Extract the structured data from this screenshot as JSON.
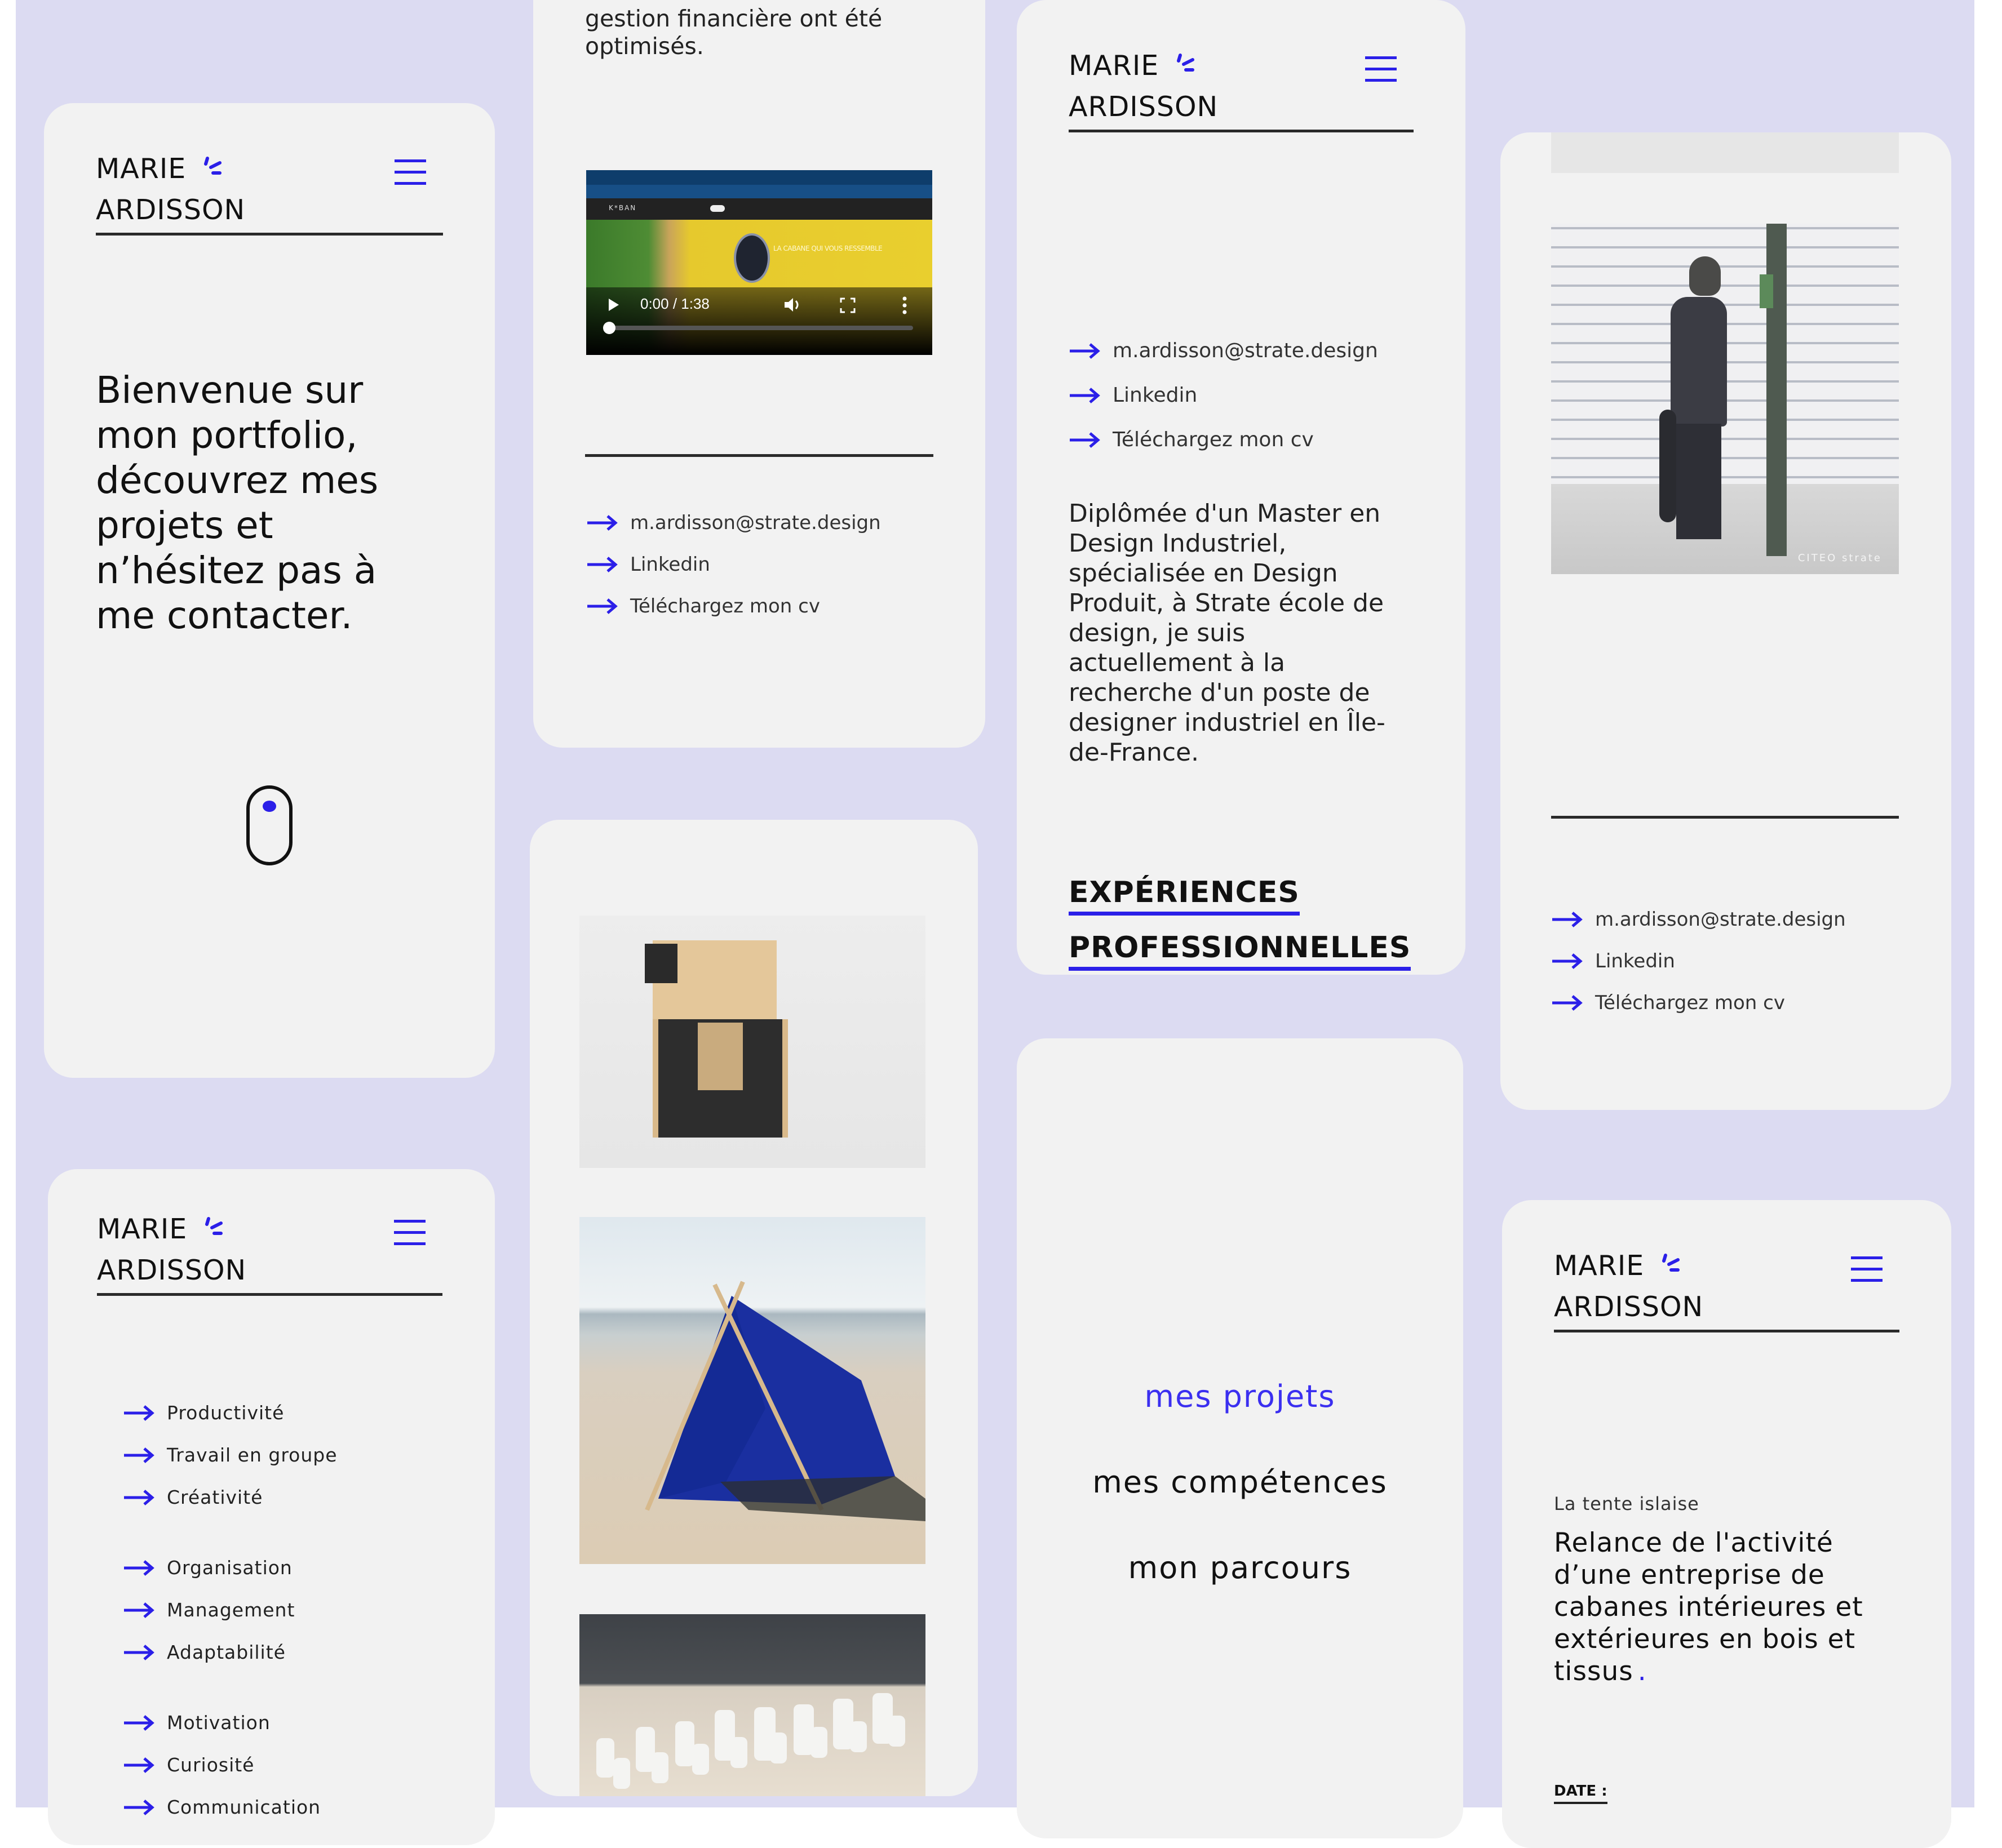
{
  "brand": {
    "first_name": "MARIE",
    "last_name": "ARDISSON",
    "accent": "#2b1fe8",
    "panel_bg": "#dcdbf2",
    "card_bg": "#f2f2f2"
  },
  "welcome": {
    "intro": "Bienvenue sur mon portfolio, découvrez mes projets et n’hésitez pas à me contacter.",
    "scroll_icon": "mouse-scroll-icon"
  },
  "project_card": {
    "text_partial": "suivi des commandes et la gestion financière ont été optimisés.",
    "video": {
      "time": "0:00 / 1:38",
      "progress": 0,
      "thumbnail_headline": "LA CABANE QUI VOUS RESSEMBLE",
      "thumbnail_site_logo": "K*BAN"
    }
  },
  "contact": {
    "links": [
      {
        "icon": "arrow-right-icon",
        "label": "m.ardisson@strate.design"
      },
      {
        "icon": "arrow-right-icon",
        "label": "Linkedin"
      },
      {
        "icon": "arrow-right-icon",
        "label": "Téléchargez mon cv"
      }
    ]
  },
  "about": {
    "bio": "Diplômée d'un Master en Design Industriel, spécialisée en Design Produit, à Strate école de design, je suis actuellement à la recherche d'un poste de designer industriel en Île-de-France.",
    "section_title_line1": "EXPÉRIENCES",
    "section_title_line2": "PROFESSIONNELLES"
  },
  "gallery": {
    "images": [
      {
        "name": "wooden-cabin-render",
        "alt": "Cabane en bois modulable"
      },
      {
        "name": "blue-tent-beach",
        "alt": "Tente bleue sur la plage"
      },
      {
        "name": "chess-set",
        "alt": "Jeu d'échecs blanc"
      }
    ]
  },
  "photo_card": {
    "image_alt": "Personne avec skateboard devant un mur de briques",
    "watermark": "CITEO strate"
  },
  "nav_menu": {
    "items": [
      {
        "label": "mes projets",
        "active": true
      },
      {
        "label": "mes compétences",
        "active": false
      },
      {
        "label": "mon parcours",
        "active": false
      }
    ]
  },
  "skills": {
    "groups": [
      [
        "Productivité",
        "Travail en groupe",
        "Créativité"
      ],
      [
        "Organisation",
        "Management",
        "Adaptabilité"
      ],
      [
        "Motivation",
        "Curiosité",
        "Communication"
      ]
    ]
  },
  "tente": {
    "eyebrow": "La tente islaise",
    "title": "Relance de l'activité d’une entreprise de cabanes intérieures et extérieures en bois et tissus",
    "title_dot": ".",
    "date_label": "DATE :"
  }
}
